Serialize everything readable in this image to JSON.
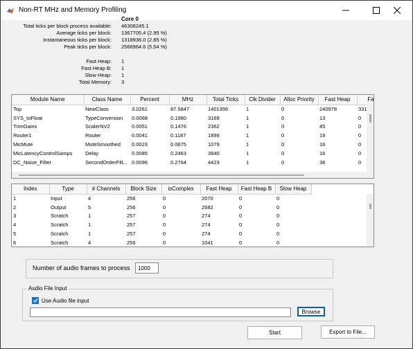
{
  "window": {
    "title": "Non-RT MHz and Memory Profiling"
  },
  "stats": {
    "core_header": "Core 0",
    "rows": [
      {
        "label": "Total ticks per block process available:",
        "value": "46308245.1"
      },
      {
        "label": "Average ticks per block:",
        "value": "1367705.4 (2.95 %)"
      },
      {
        "label": "Instantaneous ticks per block:",
        "value": "1318936.0 (2.85 %)"
      },
      {
        "label": "Peak ticks per block:",
        "value": "2566964.6 (5.54 %)"
      }
    ],
    "heap_rows": [
      {
        "label": "Fast Heap:",
        "value": "1"
      },
      {
        "label": "Fast Heap B:",
        "value": "1"
      },
      {
        "label": "Slow Heap:",
        "value": "1"
      },
      {
        "label": "Total Memory:",
        "value": "3"
      }
    ]
  },
  "module_table": {
    "columns": [
      "Module Name",
      "Class Name",
      "Percent",
      "MHz",
      "Total Ticks",
      "Clk Divider",
      "Alloc Priority",
      "Fast Heap",
      "Fa"
    ],
    "rows": [
      [
        "Top",
        "NewClass",
        "3.0261",
        "87.5847",
        "1401356",
        "1",
        "0",
        "240978",
        "331"
      ],
      [
        "SYS_toFloat",
        "TypeConversion",
        "0.0068",
        "0.1980",
        "3169",
        "1",
        "0",
        "13",
        "0"
      ],
      [
        "TrimGains",
        "ScalerNV2",
        "0.0051",
        "0.1476",
        "2362",
        "1",
        "0",
        "45",
        "0"
      ],
      [
        "Router1",
        "Router",
        "0.0041",
        "0.1187",
        "1899",
        "1",
        "0",
        "19",
        "0"
      ],
      [
        "MicMute",
        "MuteSmoothed",
        "0.0023",
        "0.0675",
        "1079",
        "1",
        "0",
        "16",
        "0"
      ],
      [
        "MicLatencyControlSamps",
        "Delay",
        "0.0085",
        "0.2463",
        "3940",
        "1",
        "0",
        "16",
        "0"
      ],
      [
        "DC_Noise_Filter",
        "SecondOrderFilt...",
        "0.0096",
        "0.2764",
        "4423",
        "1",
        "0",
        "38",
        "0"
      ]
    ]
  },
  "buffer_table": {
    "columns": [
      "Index",
      "Type",
      "# Channels",
      "Block Size",
      "isComplex",
      "Fast Heap",
      "Fast Heap B",
      "Slow Heap"
    ],
    "rows": [
      [
        "1",
        "Input",
        "4",
        "256",
        "0",
        "2070",
        "0",
        "0"
      ],
      [
        "2",
        "Output",
        "5",
        "256",
        "0",
        "2582",
        "0",
        "0"
      ],
      [
        "3",
        "Scratch",
        "1",
        "257",
        "0",
        "274",
        "0",
        "0"
      ],
      [
        "4",
        "Scratch",
        "1",
        "257",
        "0",
        "274",
        "0",
        "0"
      ],
      [
        "5",
        "Scratch",
        "1",
        "257",
        "0",
        "274",
        "0",
        "0"
      ],
      [
        "6",
        "Scratch",
        "4",
        "256",
        "0",
        "1041",
        "0",
        "0"
      ]
    ]
  },
  "frames": {
    "label": "Number of audio frames to process",
    "value": "1000"
  },
  "audio_input": {
    "group_title": "Audio File Input",
    "checkbox_label": "Use Audio file input",
    "checked": true,
    "path_value": "",
    "browse_label": "Browse"
  },
  "actions": {
    "start_label": "Start",
    "export_label": "Export to File..."
  },
  "colors": {
    "accent": "#0a5fb4",
    "check_blue": "#1a6fd0"
  }
}
